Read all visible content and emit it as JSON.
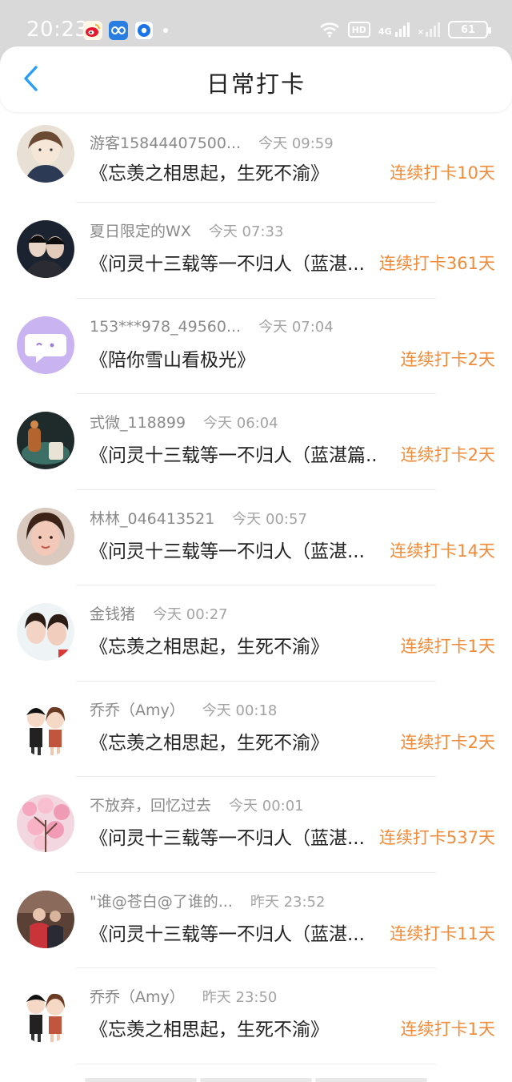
{
  "status_bar": {
    "time": "20:23",
    "network": "4G",
    "hd": "HD",
    "battery": "61",
    "apps": [
      "weibo-icon",
      "cloud-app-icon",
      "browser-icon"
    ]
  },
  "header": {
    "title": "日常打卡",
    "back_icon": "chevron-left-icon"
  },
  "colors": {
    "accent": "#2a9df4",
    "streak": "#f08b39",
    "username": "#8a8a8a",
    "time": "#a3a3a3"
  },
  "checkins": [
    {
      "user": "游客15844407500...",
      "time": "今天 09:59",
      "book": "《忘羡之相思起，生死不渝》",
      "streak": "连续打卡10天"
    },
    {
      "user": "夏日限定的WX",
      "time": "今天 07:33",
      "book": "《问灵十三载等一不归人（蓝湛...",
      "streak": "连续打卡361天"
    },
    {
      "user": "153***978_49560...",
      "time": "今天 07:04",
      "book": "《陪你雪山看极光》",
      "streak": "连续打卡2天"
    },
    {
      "user": "式微_118899",
      "time": "今天 06:04",
      "book": "《问灵十三载等一不归人（蓝湛篇...",
      "streak": "连续打卡2天"
    },
    {
      "user": "林林_046413521",
      "time": "今天 00:57",
      "book": "《问灵十三载等一不归人（蓝湛...",
      "streak": "连续打卡14天"
    },
    {
      "user": "金钱猪",
      "time": "今天 00:27",
      "book": "《忘羡之相思起，生死不渝》",
      "streak": "连续打卡1天"
    },
    {
      "user": "乔乔（Amy）",
      "time": "今天 00:18",
      "book": "《忘羡之相思起，生死不渝》",
      "streak": "连续打卡2天"
    },
    {
      "user": "不放弃，回忆过去",
      "time": "今天 00:01",
      "book": "《问灵十三载等一不归人（蓝湛...",
      "streak": "连续打卡537天"
    },
    {
      "user": "\"谁@苍白@了谁的...",
      "time": "昨天 23:52",
      "book": "《问灵十三载等一不归人（蓝湛...",
      "streak": "连续打卡11天"
    },
    {
      "user": "乔乔（Amy）",
      "time": "昨天 23:50",
      "book": "《忘羡之相思起，生死不渝》",
      "streak": "连续打卡1天"
    }
  ]
}
